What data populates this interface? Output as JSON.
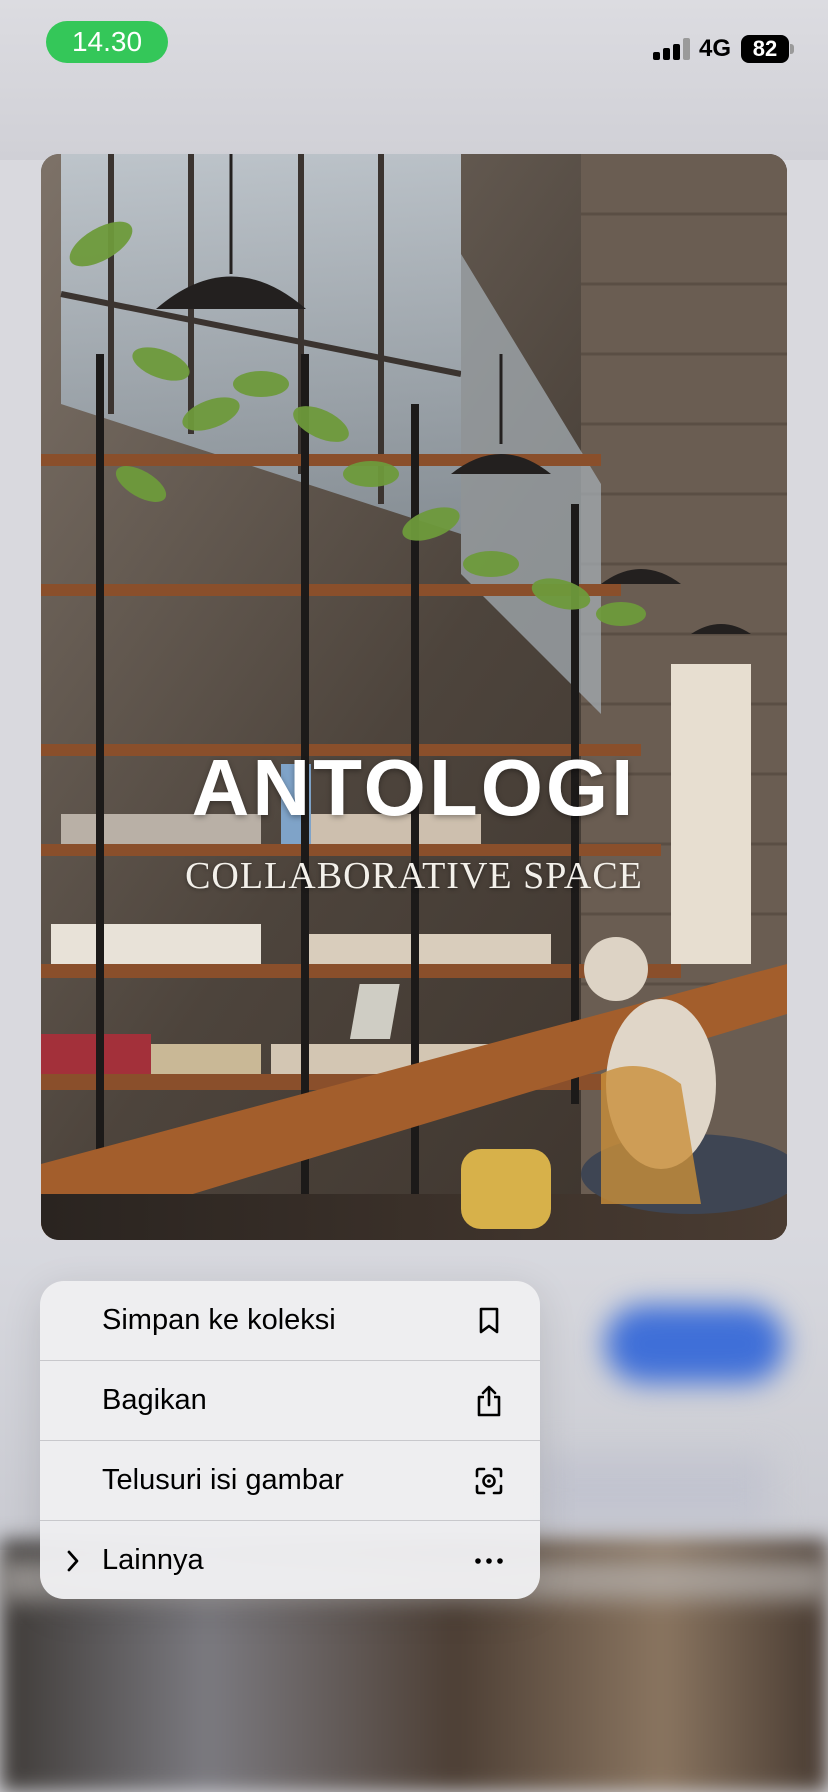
{
  "status_bar": {
    "time": "14.30",
    "network": "4G",
    "battery": "82",
    "time_pill_color": "#34c759"
  },
  "photo": {
    "title": "ANTOLOGI",
    "subtitle": "COLLABORATIVE SPACE"
  },
  "menu": {
    "items": [
      {
        "label": "Simpan ke koleksi",
        "icon": "bookmark-icon"
      },
      {
        "label": "Bagikan",
        "icon": "share-icon"
      },
      {
        "label": "Telusuri isi gambar",
        "icon": "visual-search-icon"
      },
      {
        "label": "Lainnya",
        "icon": "more-icon",
        "chevron": "chevron-right-icon"
      }
    ]
  },
  "colors": {
    "accent_blue": "#3f6fd8"
  }
}
